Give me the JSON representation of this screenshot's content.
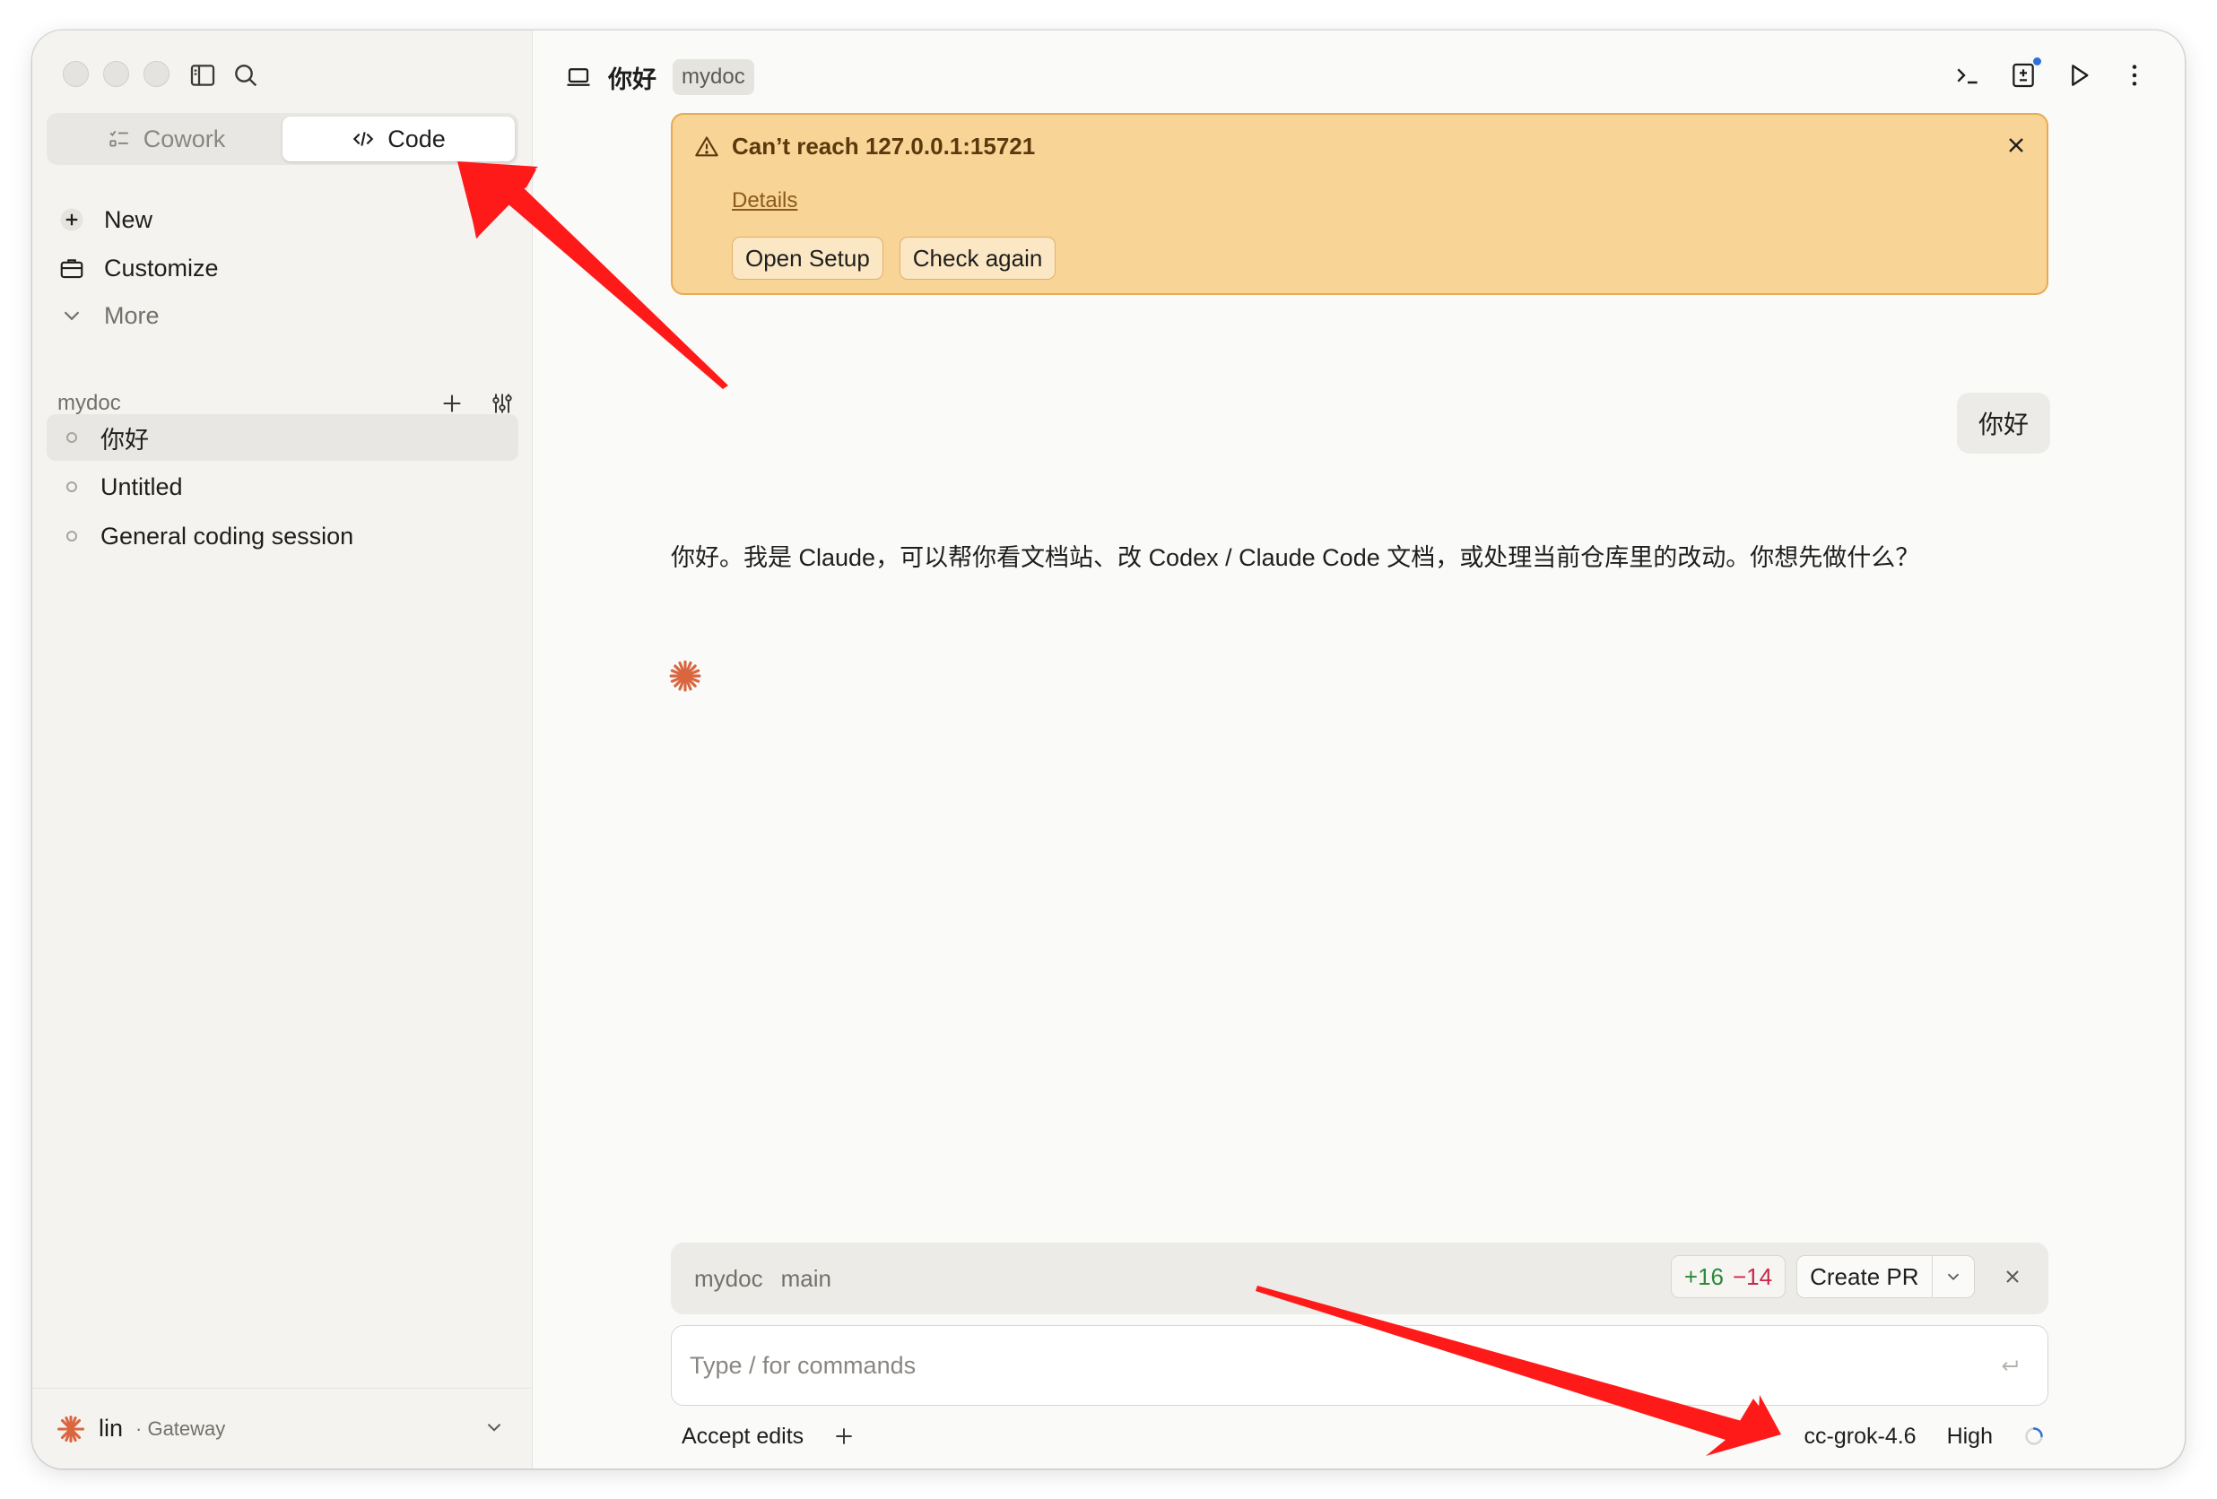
{
  "sidebar": {
    "mode_tabs": [
      {
        "label": "Cowork",
        "active": false,
        "icon": "checklist-icon"
      },
      {
        "label": "Code",
        "active": true,
        "icon": "code-icon"
      }
    ],
    "nav": {
      "new_label": "New",
      "customize_label": "Customize",
      "more_label": "More"
    },
    "project": {
      "name": "mydoc",
      "sessions": [
        {
          "label": "你好",
          "active": true
        },
        {
          "label": "Untitled",
          "active": false
        },
        {
          "label": "General coding session",
          "active": false
        }
      ]
    },
    "user": {
      "name": "lin",
      "gateway": "· Gateway"
    }
  },
  "main": {
    "title": "你好",
    "project_pill": "mydoc",
    "alert": {
      "message": "Can’t reach 127.0.0.1:15721",
      "details_link": "Details",
      "open_setup": "Open Setup",
      "check_again": "Check again"
    },
    "user_message": "你好",
    "assistant_message": "你好。我是 Claude，可以帮你看文档站、改 Codex / Claude Code 文档，或处理当前仓库里的改动。你想先做什么？",
    "branch_bar": {
      "repo": "mydoc",
      "branch": "main",
      "added": "+16",
      "removed": "−14",
      "create_pr": "Create PR"
    },
    "composer": {
      "placeholder": "Type / for commands",
      "value": ""
    },
    "footer": {
      "accept_edits": "Accept edits",
      "model": "cc-grok-4.6",
      "effort": "High"
    }
  },
  "colors": {
    "accent_claude": "#d9663f",
    "alert_bg": "#f8d497",
    "annotation_arrow": "#ff0000",
    "diff_added": "#2a8a3a",
    "diff_removed": "#c8284a"
  }
}
